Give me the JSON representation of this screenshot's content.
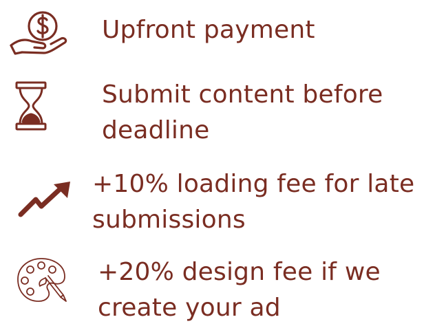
{
  "accent_color": "#7a2d22",
  "items": [
    {
      "icon": "money-hand-icon",
      "lines": [
        "Upfront payment"
      ]
    },
    {
      "icon": "hourglass-icon",
      "lines": [
        "Submit content before",
        "deadline"
      ]
    },
    {
      "icon": "trend-up-arrow-icon",
      "lines": [
        "+10% loading fee for late",
        "submissions"
      ]
    },
    {
      "icon": "paint-palette-icon",
      "lines": [
        "+20% design fee if we",
        "create your ad"
      ]
    }
  ]
}
